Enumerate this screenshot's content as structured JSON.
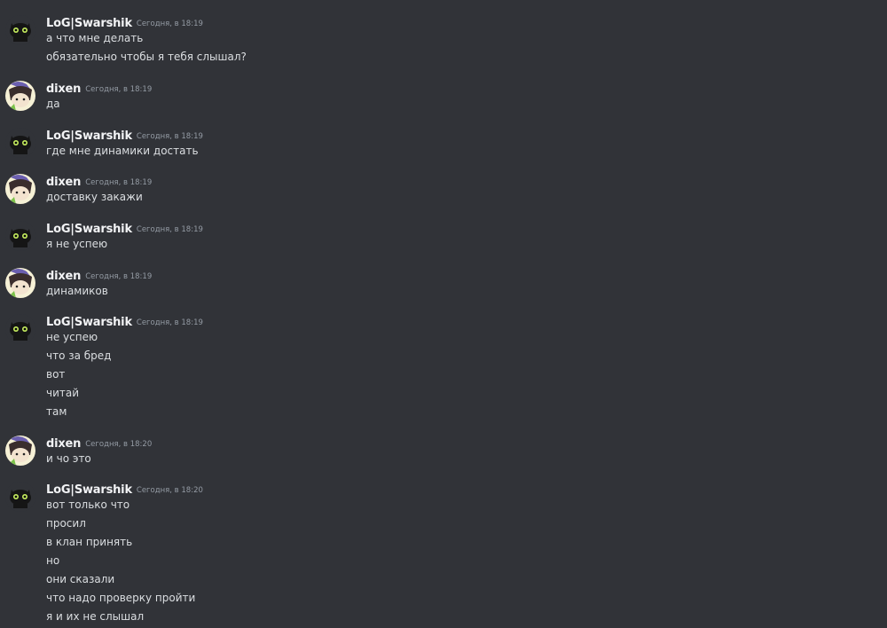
{
  "users": {
    "swarshik": {
      "name": "LoG|Swarshik",
      "icon": "black-cat-icon"
    },
    "dixen": {
      "name": "dixen",
      "icon": "anime-character-icon"
    }
  },
  "messages": [
    {
      "author": "LoG|Swarshik",
      "time": "Сегодня, в 18:19",
      "lines": [
        "а что мне делать",
        "обязательно чтобы я тебя слышал?"
      ]
    },
    {
      "author": "dixen",
      "time": "Сегодня, в 18:19",
      "lines": [
        "да"
      ]
    },
    {
      "author": "LoG|Swarshik",
      "time": "Сегодня, в 18:19",
      "lines": [
        "где мне динамики достать"
      ]
    },
    {
      "author": "dixen",
      "time": "Сегодня, в 18:19",
      "lines": [
        "доставку закажи"
      ]
    },
    {
      "author": "LoG|Swarshik",
      "time": "Сегодня, в 18:19",
      "lines": [
        "я не успею"
      ]
    },
    {
      "author": "dixen",
      "time": "Сегодня, в 18:19",
      "lines": [
        "динамиков"
      ]
    },
    {
      "author": "LoG|Swarshik",
      "time": "Сегодня, в 18:19",
      "lines": [
        "не успею",
        "что за бред",
        "вот",
        "читай",
        "там"
      ]
    },
    {
      "author": "dixen",
      "time": "Сегодня, в 18:20",
      "lines": [
        "и чо это"
      ]
    },
    {
      "author": "LoG|Swarshik",
      "time": "Сегодня, в 18:20",
      "lines": [
        "вот только что",
        "просил",
        "в клан принять",
        "но",
        "они сказали",
        "что надо проверку пройти",
        "я и их не слышал"
      ]
    }
  ]
}
